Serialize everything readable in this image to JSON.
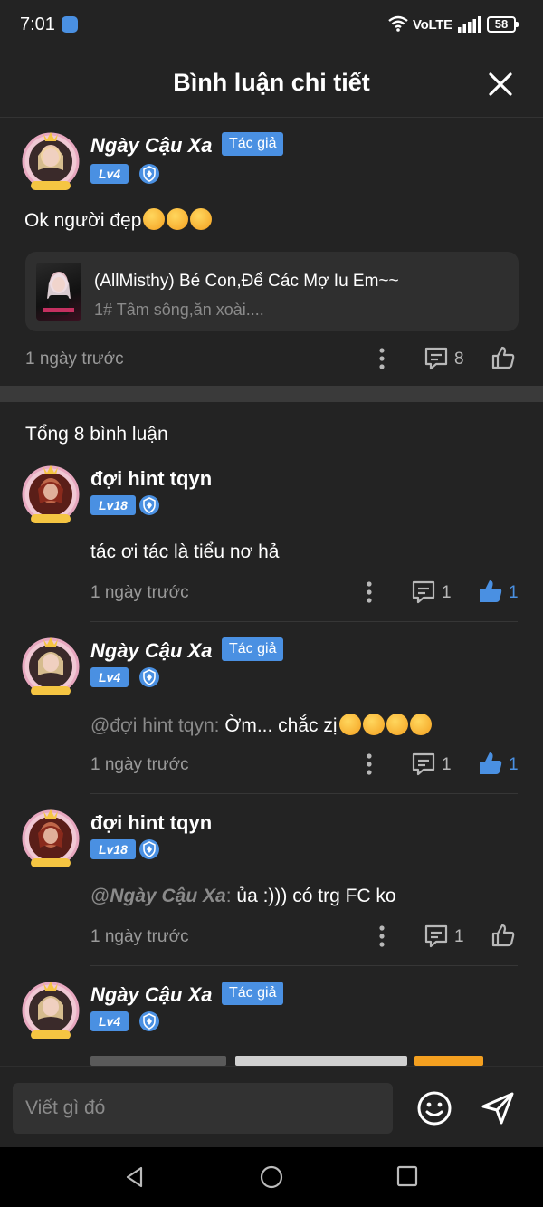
{
  "status_bar": {
    "time": "7:01",
    "network": "VoLTE",
    "battery": "58"
  },
  "header": {
    "title": "Bình luận chi tiết"
  },
  "main_comment": {
    "username": "Ngày Cậu Xa",
    "author_badge": "Tác giả",
    "level": "Lv4",
    "text": "Ok người đẹp",
    "time": "1 ngày trước",
    "reply_count": "8",
    "book": {
      "title": "(AllMisthy) Bé Con,Để Các Mợ Iu Em~~",
      "chapter": "1# Tâm sông,ăn xoài...."
    }
  },
  "total_label": "Tổng 8 bình luận",
  "replies": [
    {
      "username": "đợi hint tqyn",
      "level": "Lv18",
      "text": "tác ơi tác là tiểu nơ hả",
      "time": "1 ngày trước",
      "reply_count": "1",
      "like_count": "1"
    },
    {
      "username": "Ngày Cậu Xa",
      "author_badge": "Tác giả",
      "level": "Lv4",
      "mention": "@đợi hint tqyn:",
      "text": " Ờm... chắc zị",
      "time": "1 ngày trước",
      "reply_count": "1",
      "like_count": "1"
    },
    {
      "username": "đợi hint tqyn",
      "level": "Lv18",
      "mention_prefix": "@",
      "mention_name": "Ngày Cậu Xa",
      "mention_suffix": ":",
      "text": " ủa :))) có trg FC ko",
      "time": "1 ngày trước",
      "reply_count": "1"
    },
    {
      "username": "Ngày Cậu Xa",
      "author_badge": "Tác giả",
      "level": "Lv4"
    }
  ],
  "input": {
    "placeholder": "Viết gì đó"
  },
  "colors": {
    "accent": "#4a90e2",
    "background": "#232323",
    "card": "#2f2f2f",
    "muted": "#9a9a9a"
  },
  "icons": [
    "close-icon",
    "shield-icon",
    "more-icon",
    "reply-icon",
    "like-icon",
    "emoji-icon",
    "send-icon",
    "nav-back-icon",
    "nav-home-icon",
    "nav-recent-icon"
  ]
}
